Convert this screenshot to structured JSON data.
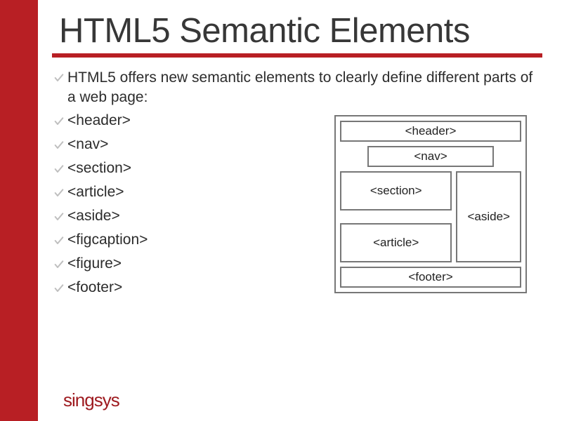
{
  "title": "HTML5 Semantic Elements",
  "intro": "HTML5 offers new semantic elements to clearly define different parts of a web page:",
  "items": [
    "<header>",
    "<nav>",
    "<section>",
    "<article>",
    "<aside>",
    "<figcaption>",
    "<figure>",
    "<footer>"
  ],
  "diagram": {
    "header": "<header>",
    "nav": "<nav>",
    "section": "<section>",
    "article": "<article>",
    "aside": "<aside>",
    "footer": "<footer>"
  },
  "brand": "singsys"
}
